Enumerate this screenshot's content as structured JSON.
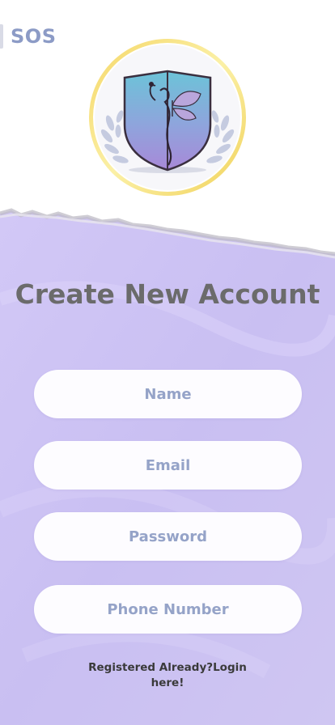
{
  "app": {
    "brand": "SOS"
  },
  "page": {
    "title": "Create New Account"
  },
  "form": {
    "name_placeholder": "Name",
    "email_placeholder": "Email",
    "password_placeholder": "Password",
    "phone_placeholder": "Phone Number"
  },
  "footer": {
    "login_link": "Registered Already?Login here!"
  },
  "colors": {
    "accent_text": "#8c9bc6",
    "background_purple": "#cdc2f4",
    "title_gray": "#6b6b6b",
    "logo_ring": "#f2e27a"
  },
  "icons": {
    "logo": "shield-butterfly-logo"
  }
}
